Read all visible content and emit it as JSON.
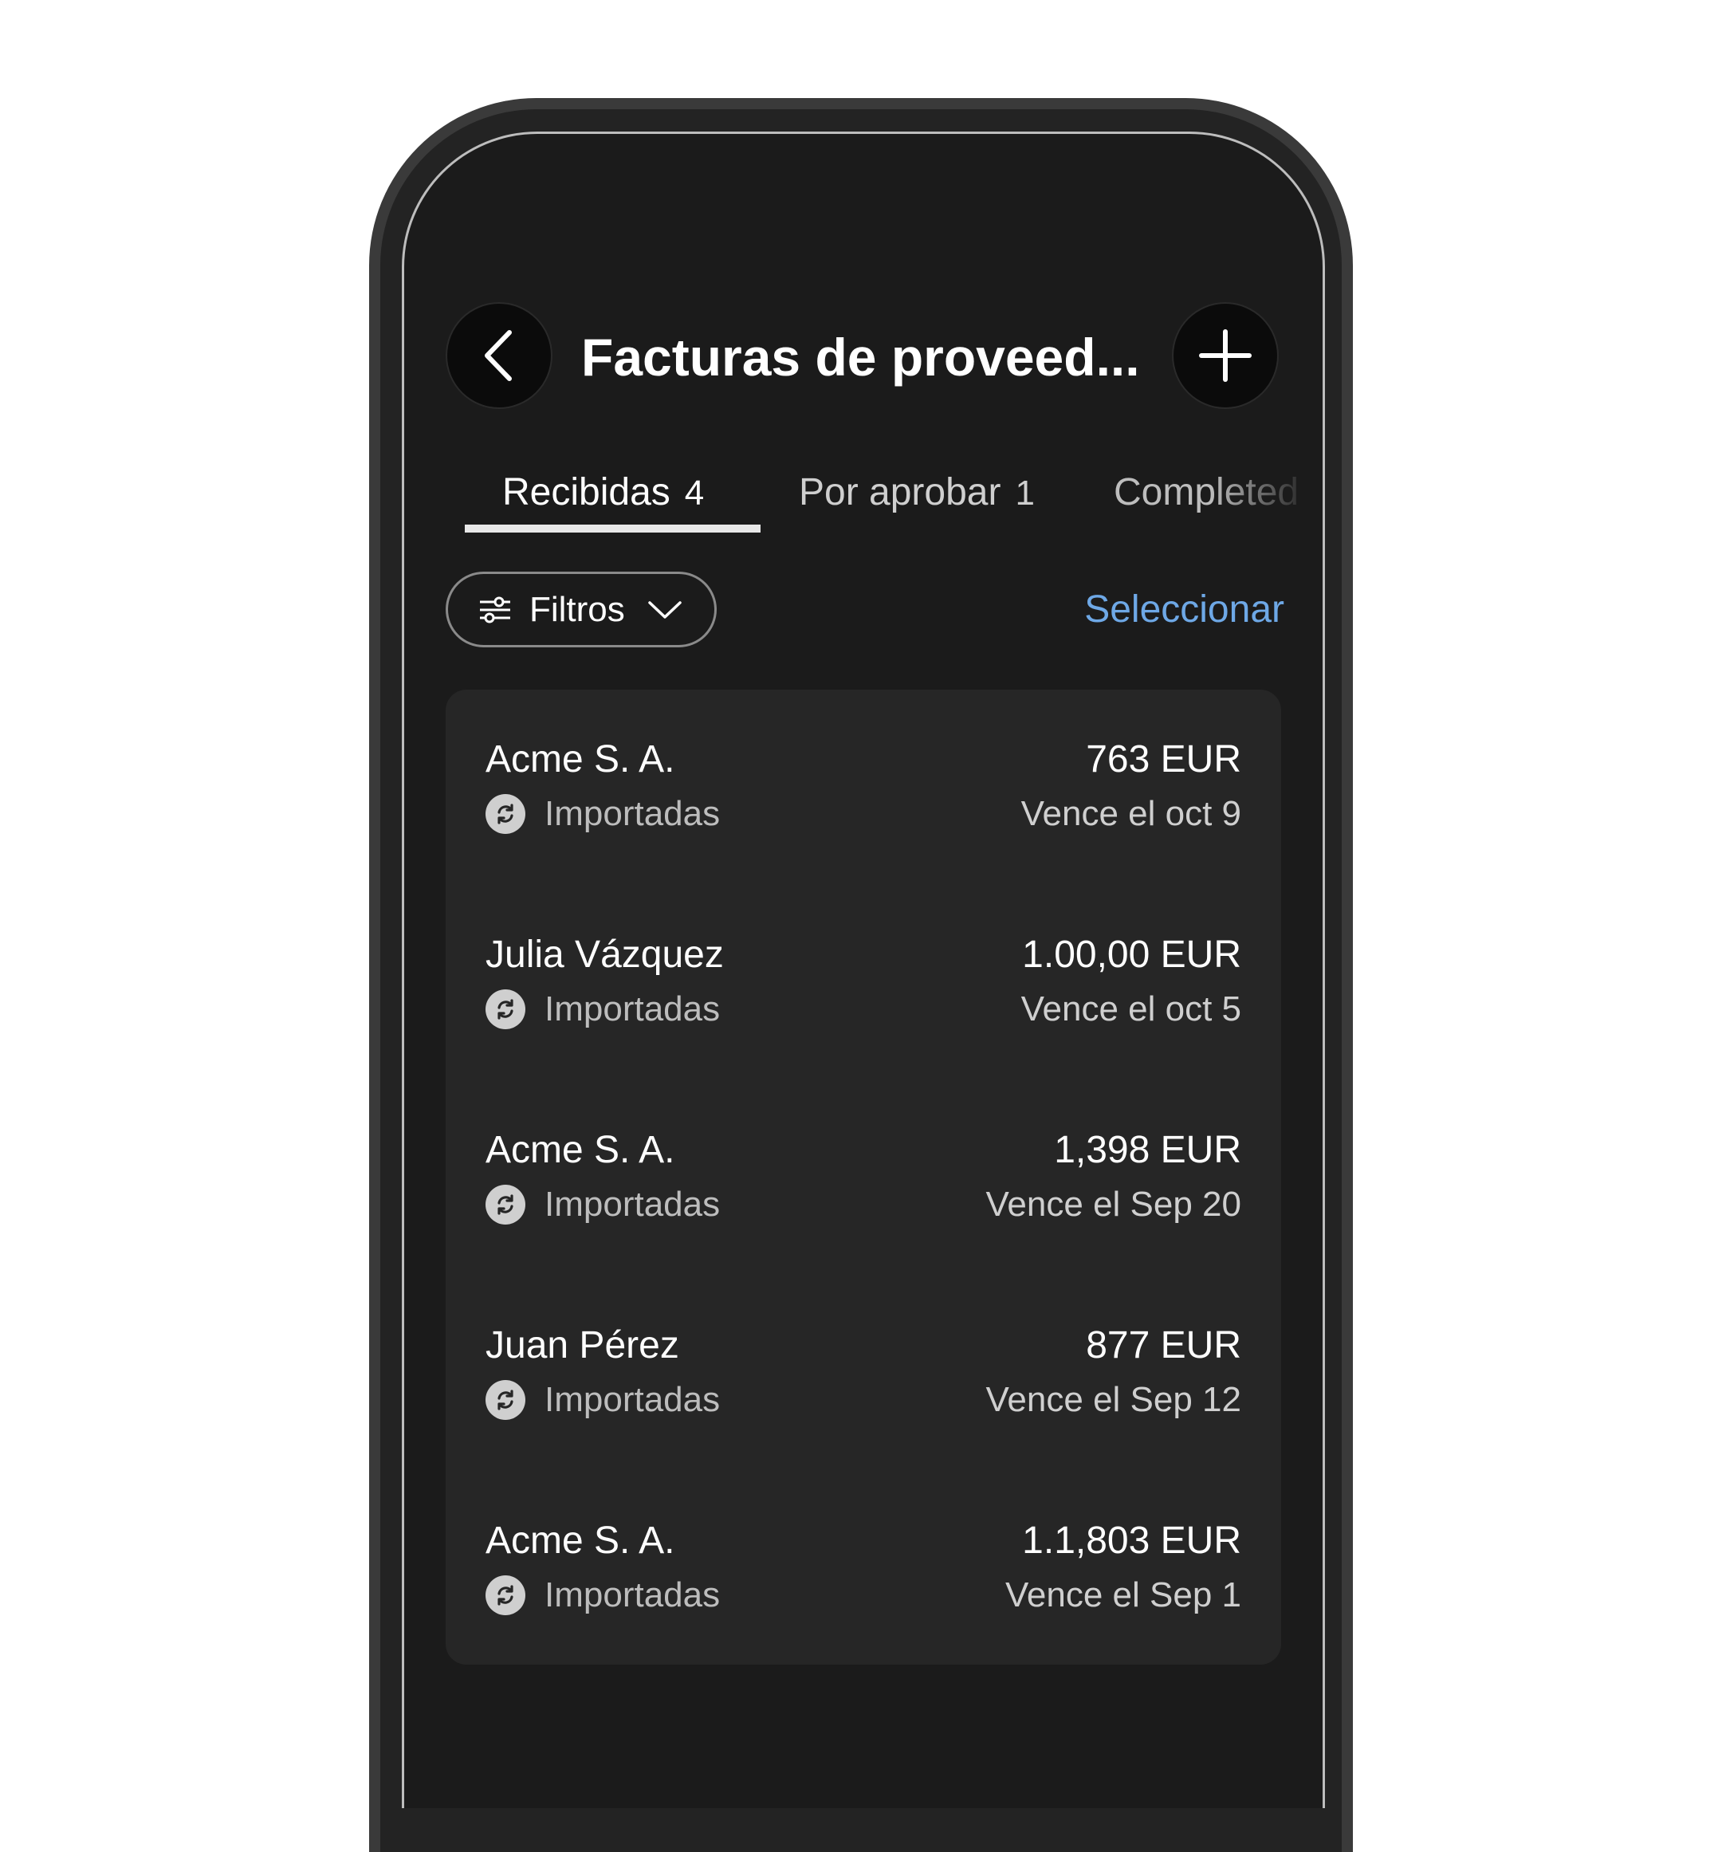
{
  "header": {
    "title": "Facturas de proveed..."
  },
  "tabs": [
    {
      "label": "Recibidas",
      "count": "4"
    },
    {
      "label": "Por aprobar",
      "count": "1"
    },
    {
      "label": "Completed",
      "count": ""
    }
  ],
  "toolbar": {
    "filters_label": "Filtros",
    "select_label": "Seleccionar"
  },
  "invoices": [
    {
      "vendor": "Acme S. A.",
      "status": "Importadas",
      "amount": "763 EUR",
      "due": "Vence el oct 9"
    },
    {
      "vendor": "Julia Vázquez",
      "status": "Importadas",
      "amount": "1.00,00 EUR",
      "due": "Vence el oct 5"
    },
    {
      "vendor": "Acme S. A.",
      "status": "Importadas",
      "amount": "1,398 EUR",
      "due": "Vence el Sep 20"
    },
    {
      "vendor": "Juan Pérez",
      "status": "Importadas",
      "amount": "877 EUR",
      "due": "Vence el Sep 12"
    },
    {
      "vendor": "Acme S. A.",
      "status": "Importadas",
      "amount": "1.1,803 EUR",
      "due": "Vence el Sep 1"
    }
  ],
  "icons": {
    "back": "chevron-left-icon",
    "add": "plus-icon",
    "filters": "sliders-icon",
    "dropdown": "chevron-down-icon",
    "status": "sync-icon"
  },
  "colors": {
    "screen_bg": "#1b1b1b",
    "card_bg": "#262626",
    "accent_link": "#6ea8e6",
    "text_primary": "#ffffff",
    "text_secondary": "#bdbdbd"
  }
}
